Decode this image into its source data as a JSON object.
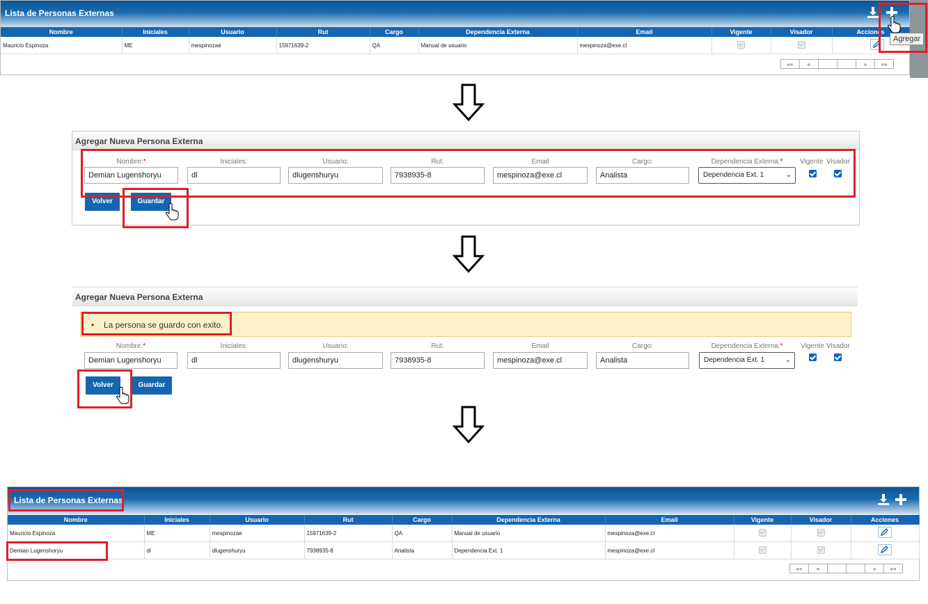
{
  "colors": {
    "header_blue": "#1565b0",
    "highlight_red": "#e01e2a",
    "alert_bg": "#fcf1c9"
  },
  "list": {
    "title": "Lista de Personas Externas",
    "headers": [
      "Nombre",
      "Iniciales",
      "Usuario",
      "Rut",
      "Cargo",
      "Dependencia Externa",
      "Email",
      "Vigente",
      "Visador",
      "Acciones"
    ],
    "rows_before": [
      [
        "Mauricio Espinoza",
        "ME",
        "mespinozae",
        "15971639-2",
        "QA",
        "Manual de usuario",
        "mespinoza@exe.cl"
      ]
    ],
    "rows_after": [
      [
        "Mauricio Espinoza",
        "ME",
        "mespinozae",
        "15971639-2",
        "QA",
        "Manual de usuario",
        "mespinoza@exe.cl"
      ],
      [
        "Demian Lugenshoryu",
        "dl",
        "dlugenshuryu",
        "7938935-8",
        "Analista",
        "Dependencia Ext. 1",
        "mespinoza@exe.cl"
      ]
    ],
    "pager": [
      "««",
      "«",
      "",
      "",
      "»",
      "»»"
    ],
    "download_icon": "download-icon",
    "add_icon": "plus-icon",
    "tooltip": "Agregar"
  },
  "form": {
    "title": "Agregar Nueva Persona Externa",
    "labels": {
      "nombre": "Nombre:",
      "iniciales": "Iniciales:",
      "usuario": "Usuario:",
      "rut": "Rut:",
      "email": "Email",
      "cargo": "Cargo:",
      "dependencia": "Dependencia Externa:",
      "vigente": "Vigente",
      "visador": "Visador",
      "required_mark": "*"
    },
    "values": {
      "nombre": "Demian Lugenshoryu",
      "iniciales": "dl",
      "usuario": "dlugenshuryu",
      "rut": "7938935-8",
      "email": "mespinoza@exe.cl",
      "cargo": "Analista",
      "dependencia": "Dependencia Ext. 1"
    },
    "volver": "Volver",
    "guardar": "Guardar",
    "success_message": "La persona se guardo con exito."
  }
}
